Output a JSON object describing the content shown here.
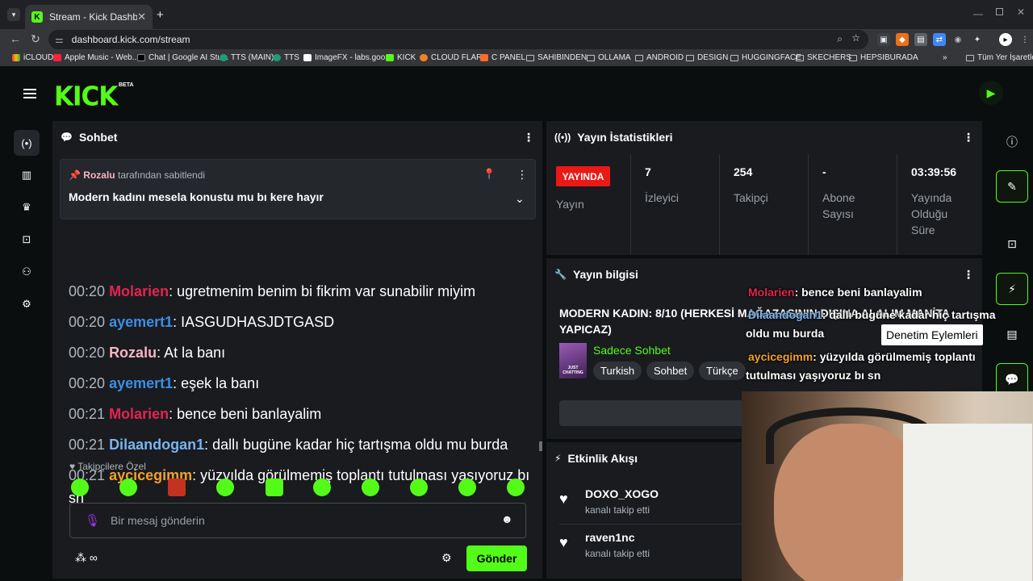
{
  "browser": {
    "tab_title": "Stream - Kick Dashboard",
    "tab_favicon": "K",
    "url": "dashboard.kick.com/stream",
    "bookmarks": [
      {
        "label": "iCLOUD",
        "icon": "colorful"
      },
      {
        "label": "Apple Music - Web...",
        "icon": "red"
      },
      {
        "label": "Chat | Google AI Stu...",
        "icon": "dark"
      },
      {
        "label": "TTS (MAIN)",
        "icon": "globe"
      },
      {
        "label": "TTS",
        "icon": "globe"
      },
      {
        "label": "ImageFX - labs.goo...",
        "icon": "white"
      },
      {
        "label": "KICK",
        "icon": "green"
      },
      {
        "label": "CLOUD FLARE",
        "icon": "orange"
      },
      {
        "label": "C PANEL",
        "icon": "orange"
      },
      {
        "label": "SAHIBINDEN",
        "icon": "folder"
      },
      {
        "label": "OLLAMA",
        "icon": "folder"
      },
      {
        "label": "ANDROID",
        "icon": "folder"
      },
      {
        "label": "DESIGN",
        "icon": "folder"
      },
      {
        "label": "HUGGINGFACE",
        "icon": "folder"
      },
      {
        "label": "SKECHERS",
        "icon": "folder"
      },
      {
        "label": "HEPSIBURADA",
        "icon": "folder"
      }
    ],
    "bookmarks_overflow": "»",
    "all_bookmarks": "Tüm Yer İşaretleri"
  },
  "kick": {
    "logo": "KICK",
    "beta": "BETA",
    "accent": "#53fc18"
  },
  "chat": {
    "title": "Sohbet",
    "pinned": {
      "author": "Rozalu",
      "suffix": "tarafından sabitlendi",
      "text": "Modern kadını mesela konustu mu bı kere hayır"
    },
    "messages": [
      {
        "time": "00:20",
        "user": "Molarien",
        "color": "#e1254f",
        "text": ": ugretmenim benim bi fikrim var sunabilir miyim"
      },
      {
        "time": "00:20",
        "user": "ayemert1",
        "color": "#3d8ee6",
        "text": ": IASGUDHASJDTGASD"
      },
      {
        "time": "00:20",
        "user": "Rozalu",
        "color": "#f7b6c2",
        "text": ": At la banı"
      },
      {
        "time": "00:20",
        "user": "ayemert1",
        "color": "#3d8ee6",
        "text": ": eşek la banı"
      },
      {
        "time": "00:21",
        "user": "Molarien",
        "color": "#e1254f",
        "text": ": bence beni banlayalim"
      },
      {
        "time": "00:21",
        "user": "Dilaandogan1",
        "color": "#79b4f2",
        "text": ": dallı bugüne kadar hiç tartışma oldu mu burda"
      },
      {
        "time": "00:21",
        "user": "aycicegimm",
        "color": "#f4a02a",
        "text": ": yüzyılda görülmemiş toplantı tutulması yaşıyoruz bı sn"
      }
    ],
    "followers_only": "Takipçilere Özel",
    "input_placeholder": "Bir mesaj gönderin",
    "send_label": "Gönder"
  },
  "stats": {
    "title": "Yayın İstatistikleri",
    "live_badge": "YAYINDA",
    "live_label": "Yayın",
    "viewers_value": "7",
    "viewers_label": "İzleyici",
    "followers_value": "254",
    "followers_label": "Takipçi",
    "subs_value": "-",
    "subs_label_1": "Abone",
    "subs_label_2": "Sayısı",
    "uptime_value": "03:39:56",
    "uptime_label_1": "Yayında",
    "uptime_label_2": "Olduğu",
    "uptime_label_3": "Süre"
  },
  "stream_info": {
    "title": "Yayın bilgisi",
    "stream_title_1": "MODERN KADIN: 8/10 (HERKESİ MAĞAZASININ DIŞINA ALALIM MANİTA",
    "stream_title_2": "YAPICAZ)",
    "category": "Sadece Sohbet",
    "category_thumb": "JUST CHATTING",
    "tags": [
      "Turkish",
      "Sohbet",
      "Türkçe"
    ]
  },
  "activity": {
    "title": "Etkinlik Akışı",
    "events": [
      {
        "user": "DOXO_XOGO",
        "action": "kanalı takip etti"
      },
      {
        "user": "raven1nc",
        "action": "kanalı takip etti"
      }
    ]
  },
  "overlay": {
    "lines": [
      {
        "user": "Molarien",
        "color": "#e1254f",
        "text": ": bence beni banlayalim"
      },
      {
        "user": "Dilaandogan1",
        "color": "#79b4f2",
        "text": ": dallı bugüne kadar hiç tartışma"
      },
      {
        "text": "oldu mu burda"
      },
      {
        "user": "aycicegimm",
        "color": "#f4a02a",
        "text": ": yüzyılda görülmemiş toplantı"
      },
      {
        "text": "tutulması yaşıyoruz bı sn"
      }
    ],
    "tooltip": "Denetim Eylemleri"
  }
}
